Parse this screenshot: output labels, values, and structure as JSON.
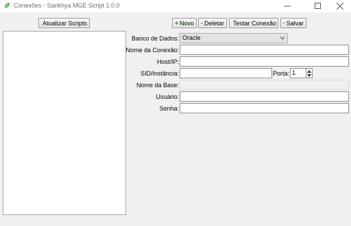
{
  "window": {
    "title": "Conexões - Sankhya MGE Script 1.0.0",
    "controls": [
      "minimize",
      "maximize",
      "close"
    ]
  },
  "left": {
    "refresh_label": "Atualizar Scripts",
    "scripts": []
  },
  "toolbar": {
    "new_label": "Novo",
    "delete_label": "Deletar",
    "test_label": "Testar Conexão",
    "save_label": "Salvar"
  },
  "form": {
    "db_label": "Banco de Dados:",
    "db_value": "Oracle",
    "name_label": "Nome da Conexão:",
    "name_value": "",
    "host_label": "Host/IP:",
    "host_value": "",
    "sid_label": "SID/Instância:",
    "sid_value": "",
    "port_label": "Porta:",
    "port_value": "1",
    "base_label": "Nome da Base:",
    "base_value": "",
    "user_label": "Usuário:",
    "user_value": "",
    "pass_label": "Senha:",
    "pass_value": ""
  },
  "colors": {
    "new_icon": "#2e8b2e",
    "delete_icon": "#d42020",
    "refresh_icon": "#2e9a2e",
    "save_icon": "#2a6fc0"
  }
}
